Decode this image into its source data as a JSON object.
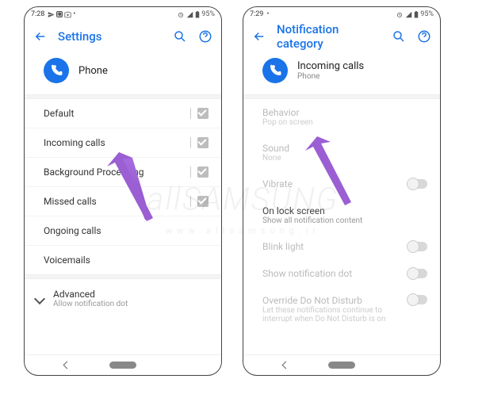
{
  "watermark": {
    "main": "allSAMSUNG",
    "sub": "www.allsamsung.ir"
  },
  "left": {
    "status": {
      "time": "7:28",
      "battery": "95%"
    },
    "title": "Settings",
    "app": {
      "name": "Phone"
    },
    "categories": [
      {
        "label": "Default"
      },
      {
        "label": "Incoming calls"
      },
      {
        "label": "Background Processing"
      },
      {
        "label": "Missed calls"
      },
      {
        "label": "Ongoing calls"
      },
      {
        "label": "Voicemails"
      }
    ],
    "advanced": {
      "title": "Advanced",
      "subtitle": "Allow notification dot"
    }
  },
  "right": {
    "status": {
      "time": "7:29",
      "battery": "95%"
    },
    "title": "Notification category",
    "app": {
      "name": "Incoming calls",
      "sub": "Phone"
    },
    "items": {
      "behavior": {
        "h": "Behavior",
        "s": "Pop on screen"
      },
      "sound": {
        "h": "Sound",
        "s": "None"
      },
      "vibrate": {
        "h": "Vibrate"
      },
      "lock": {
        "h": "On lock screen",
        "s": "Show all notification content"
      },
      "blink": {
        "h": "Blink light"
      },
      "dot": {
        "h": "Show notification dot"
      },
      "dnd": {
        "h": "Override Do Not Disturb",
        "s": "Let these notifications continue to interrupt when Do Not Disturb is on"
      }
    }
  }
}
